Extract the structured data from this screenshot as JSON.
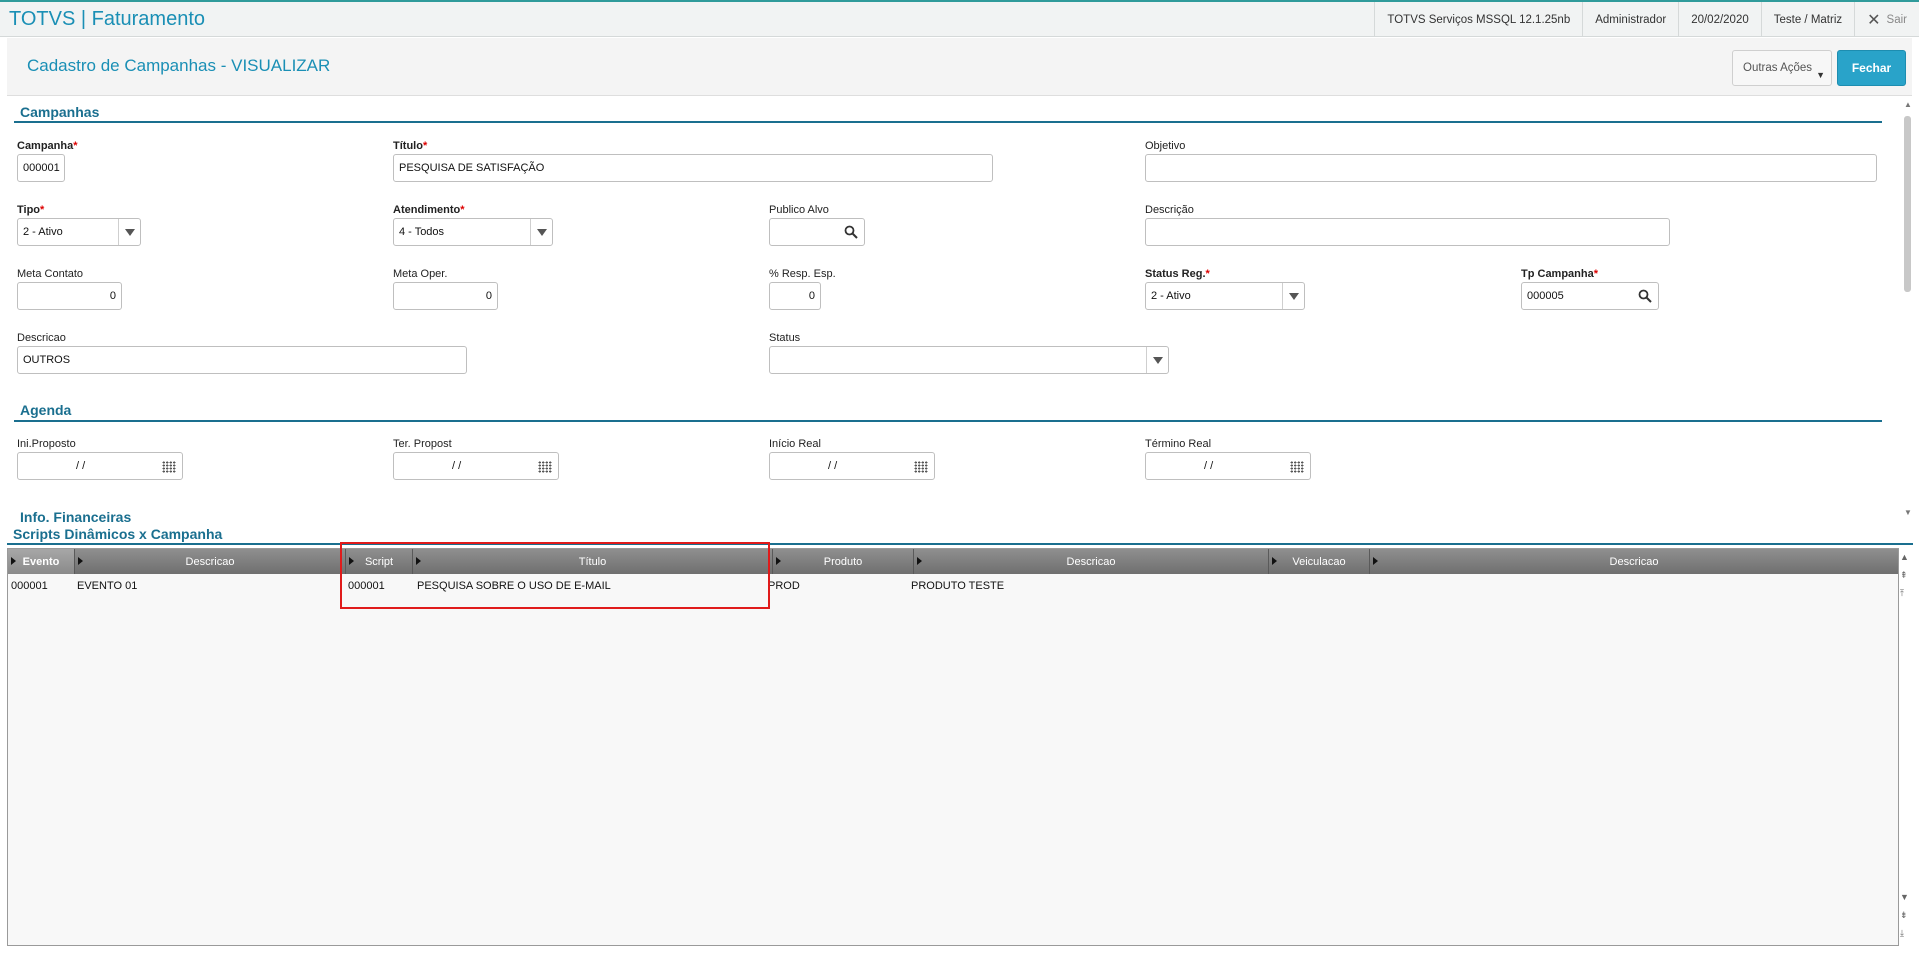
{
  "topbar": {
    "app_title": "TOTVS | Faturamento",
    "server": "TOTVS Serviços MSSQL 12.1.25nb",
    "user": "Administrador",
    "date": "20/02/2020",
    "branch": "Teste / Matriz",
    "logout": "Sair"
  },
  "header": {
    "page_title": "Cadastro de Campanhas - VISUALIZAR",
    "more_actions": "Outras Ações",
    "close": "Fechar"
  },
  "sections": {
    "campanhas": "Campanhas",
    "agenda": "Agenda",
    "info_financeiras": "Info. Financeiras",
    "scripts": "Scripts Dinâmicos x Campanha"
  },
  "fields": {
    "campanha": {
      "label": "Campanha",
      "value": "000001"
    },
    "titulo": {
      "label": "Título",
      "value": "PESQUISA DE SATISFAÇÃO"
    },
    "objetivo": {
      "label": "Objetivo",
      "value": ""
    },
    "tipo": {
      "label": "Tipo",
      "value": "2 - Ativo"
    },
    "atendimento": {
      "label": "Atendimento",
      "value": "4 - Todos"
    },
    "publico_alvo": {
      "label": "Publico Alvo",
      "value": ""
    },
    "descricao_top": {
      "label": "Descrição",
      "value": ""
    },
    "meta_contato": {
      "label": "Meta Contato",
      "value": "0"
    },
    "meta_oper": {
      "label": "Meta Oper.",
      "value": "0"
    },
    "resp_esp": {
      "label": "% Resp. Esp.",
      "value": "0"
    },
    "status_reg": {
      "label": "Status Reg.",
      "value": "2 - Ativo"
    },
    "tp_campanha": {
      "label": "Tp Campanha",
      "value": "000005"
    },
    "descricao": {
      "label": "Descricao",
      "value": "OUTROS"
    },
    "status": {
      "label": "Status",
      "value": ""
    },
    "ini_proposto": {
      "label": "Ini.Proposto",
      "value": "/ /"
    },
    "ter_propost": {
      "label": "Ter. Propost",
      "value": "/ /"
    },
    "inicio_real": {
      "label": "Início Real",
      "value": "/ /"
    },
    "termino_real": {
      "label": "Término Real",
      "value": "/ /"
    }
  },
  "required_mark": "*",
  "grid": {
    "columns": [
      "Evento",
      "Descricao",
      "Script",
      "Título",
      "Produto",
      "Descricao",
      "Veiculacao",
      "Descricao"
    ],
    "rows": [
      [
        "000001",
        "EVENTO 01",
        "000001",
        "PESQUISA SOBRE O USO DE E-MAIL",
        "PROD",
        "PRODUTO TESTE",
        "",
        ""
      ]
    ]
  },
  "icons": {
    "close": "close-icon",
    "dropdown": "chevron-down-icon",
    "lookup": "search-icon",
    "calendar": "calendar-icon"
  },
  "colors": {
    "accent": "#1a8fb5",
    "section": "#1a6f8f",
    "button_primary": "#29a3c9",
    "required": "#dd0000",
    "highlight": "#e01b1b"
  }
}
